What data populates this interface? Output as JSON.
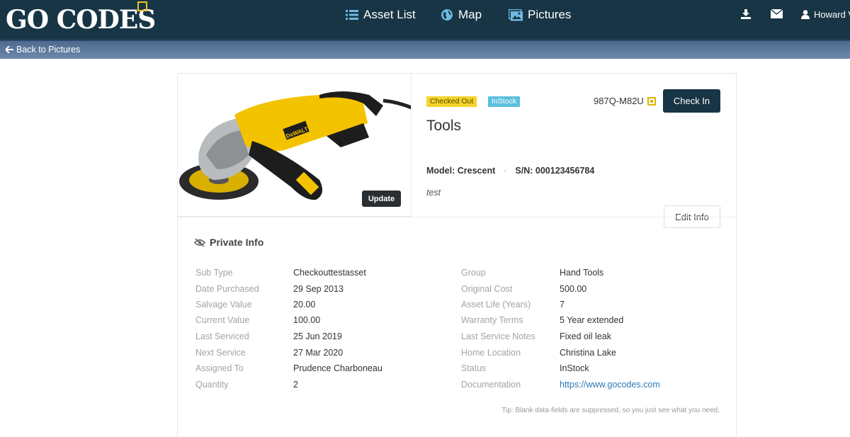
{
  "brand": {
    "logo_text": "GO CODES",
    "accent": "#f2c21c",
    "nav_bg": "#173545"
  },
  "nav": {
    "items": [
      {
        "label": "Asset List",
        "icon": "list-icon"
      },
      {
        "label": "Map",
        "icon": "globe-icon"
      },
      {
        "label": "Pictures",
        "icon": "pictures-icon"
      }
    ],
    "right_icons": [
      "download-icon",
      "mail-icon"
    ],
    "user": "Howard V"
  },
  "subnav": {
    "back_label": "Back to Pictures"
  },
  "asset": {
    "badge_status": "Checked Out",
    "badge_stock": "InStock",
    "code": "987Q-M82U",
    "check_in_label": "Check In",
    "update_label": "Update",
    "title": "Tools",
    "model": "Model: Crescent",
    "separator": "·",
    "serial": "S/N: 000123456784",
    "note": "test",
    "edit_label": "Edit Info"
  },
  "private_info": {
    "heading": "Private Info",
    "left": [
      {
        "label": "Sub Type",
        "value": "Checkouttestasset"
      },
      {
        "label": "Date Purchased",
        "value": "29 Sep 2013"
      },
      {
        "label": "Salvage Value",
        "value": "20.00"
      },
      {
        "label": "Current Value",
        "value": "100.00"
      },
      {
        "label": "Last Serviced",
        "value": "25 Jun 2019"
      },
      {
        "label": "Next Service",
        "value": "27 Mar 2020"
      },
      {
        "label": "Assigned To",
        "value": "Prudence Charboneau"
      },
      {
        "label": "Quantity",
        "value": "2"
      }
    ],
    "right": [
      {
        "label": "Group",
        "value": "Hand Tools"
      },
      {
        "label": "Original Cost",
        "value": "500.00"
      },
      {
        "label": "Asset Life (Years)",
        "value": "7"
      },
      {
        "label": "Warranty Terms",
        "value": "5 Year extended"
      },
      {
        "label": "Last Service Notes",
        "value": "Fixed oil leak"
      },
      {
        "label": "Home Location",
        "value": "Christina Lake"
      },
      {
        "label": "Status",
        "value": "InStock"
      },
      {
        "label": "Documentation",
        "value": "https://www.gocodes.com"
      }
    ],
    "tip": "Tip: Blank data-fields are suppressed, so you just see what you need."
  }
}
